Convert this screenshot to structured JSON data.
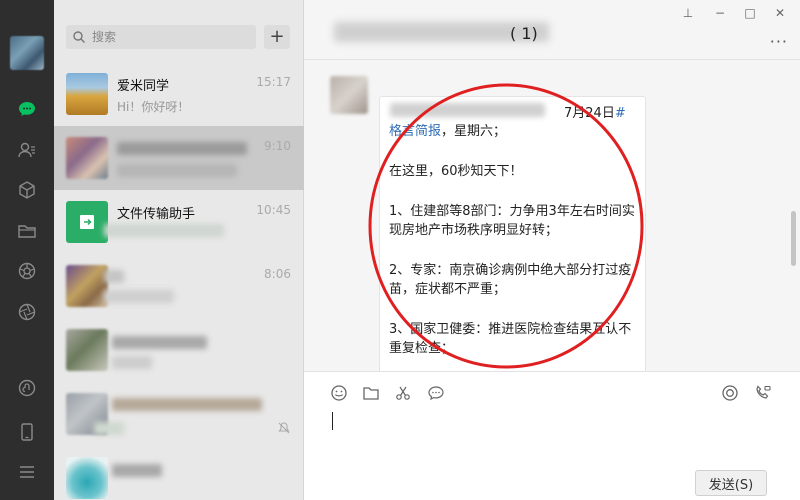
{
  "search": {
    "placeholder": "搜索"
  },
  "add_label": "+",
  "chats": [
    {
      "name": "爱米同学",
      "preview": "Hi！你好呀！",
      "time": "15:17"
    },
    {
      "name": "",
      "preview": "",
      "time": "9:10"
    },
    {
      "name": "文件传输助手",
      "preview": "",
      "time": "10:45"
    },
    {
      "name": "",
      "preview": "",
      "time": "8:06"
    },
    {
      "name": "",
      "preview": "",
      "time": ""
    },
    {
      "name": "",
      "preview": "",
      "time": ""
    },
    {
      "name": "",
      "preview": "",
      "time": ""
    }
  ],
  "header": {
    "title_suffix": "(   1)",
    "more": "···"
  },
  "window_controls": {
    "pin": "⊥",
    "minimize": "−",
    "maximize": "□",
    "close": "✕"
  },
  "message": {
    "date": "7月24日",
    "hash": "#",
    "lines": [
      {
        "link": "格言简报",
        "text": "，星期六；"
      },
      {
        "text": ""
      },
      {
        "text": "在这里，60秒知天下！"
      },
      {
        "text": ""
      },
      {
        "text": "1、住建部等8部门：力争用3年左右时间实现房地产市场秩序明显好转；"
      },
      {
        "text": ""
      },
      {
        "text": "2、专家：南京确诊病例中绝大部分打过疫苗，症状都不严重；"
      },
      {
        "text": ""
      },
      {
        "text": "3、国家卫健委：推进医院检查结果互认不重复检查；"
      }
    ]
  },
  "send_label": "发送(S)",
  "colors": {
    "nav_bg": "#2e2e2e",
    "list_bg": "#e8e8e8",
    "active_item": "#c9c9c9",
    "accent_green": "#07c160",
    "annotation_red": "#e02020",
    "link_blue": "#2f6db5"
  }
}
